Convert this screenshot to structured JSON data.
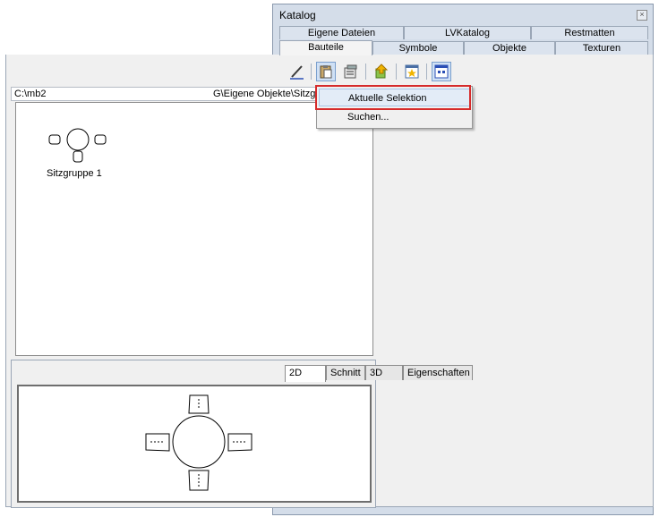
{
  "panel": {
    "title": "Katalog",
    "close_glyph": "×",
    "tabs_row1": [
      "Eigene Dateien",
      "LVKatalog",
      "Restmatten"
    ],
    "tabs_row2": [
      "Bauteile",
      "Symbole",
      "Objekte",
      "Texturen"
    ],
    "active_tab": "Bauteile"
  },
  "toolbar": {
    "buttons": [
      "draw-icon",
      "paste-icon",
      "properties-icon",
      "export-icon",
      "favorite-icon",
      "calendar-grid-icon"
    ]
  },
  "path_bar": {
    "left_text": "C:\\mb2",
    "right_text": "G\\Eigene Objekte\\Sitzgruppen"
  },
  "list": {
    "items": [
      {
        "label": "Sitzgruppe 1"
      }
    ]
  },
  "context_menu": {
    "items": [
      "Aktuelle Selektion",
      "Suchen..."
    ],
    "highlight_color": "#d62b2b"
  },
  "preview": {
    "tabs": [
      "2D",
      "Schnitt",
      "3D",
      "Eigenschaften"
    ],
    "active_tab": "2D"
  },
  "colors": {
    "selection_handles": "#1a1aa8",
    "arrows": "#1010ff",
    "outline": "#d42020"
  }
}
